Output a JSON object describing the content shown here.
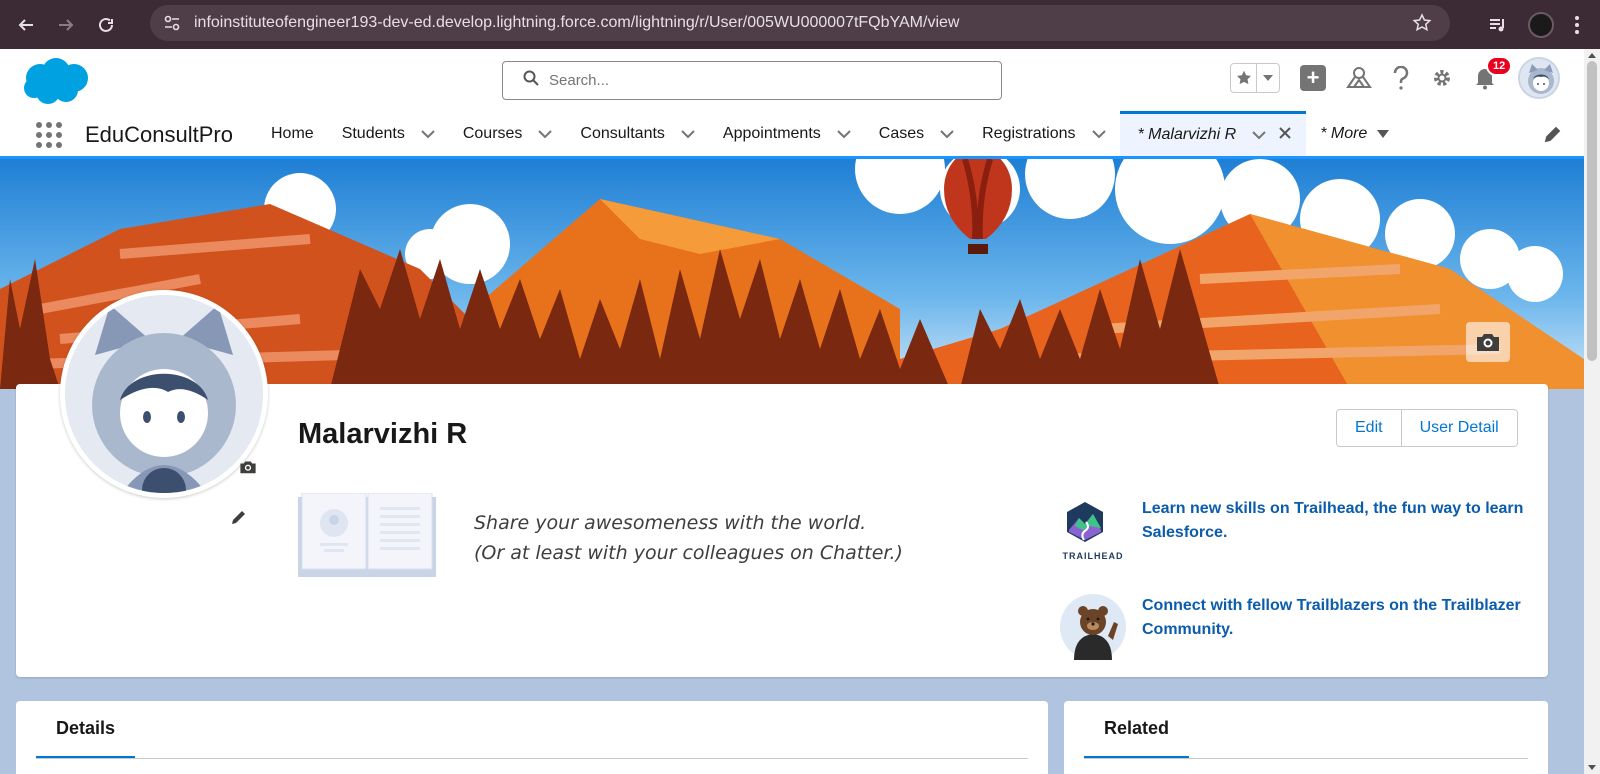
{
  "browser": {
    "url": "infoinstituteofengineer193-dev-ed.develop.lightning.force.com/lightning/r/User/005WU000007tFQbYAM/view"
  },
  "header": {
    "search_placeholder": "Search...",
    "notification_count": "12"
  },
  "nav": {
    "app_name": "EduConsultPro",
    "items": [
      {
        "label": "Home",
        "has_menu": false
      },
      {
        "label": "Students",
        "has_menu": true
      },
      {
        "label": "Courses",
        "has_menu": true
      },
      {
        "label": "Consultants",
        "has_menu": true
      },
      {
        "label": "Appointments",
        "has_menu": true
      },
      {
        "label": "Cases",
        "has_menu": true
      },
      {
        "label": "Registrations",
        "has_menu": true
      }
    ],
    "active_tab": "* Malarvizhi R",
    "more_label": "* More"
  },
  "profile": {
    "name": "Malarvizhi R",
    "edit_button": "Edit",
    "user_detail_button": "User Detail",
    "about_line1": "Share your awesomeness with the world.",
    "about_line2": "(Or at least with your colleagues on Chatter.)",
    "trailhead_label": "TRAILHEAD",
    "promo_trailhead": "Learn new skills on Trailhead, the fun way to learn Salesforce.",
    "promo_community": "Connect with fellow Trailblazers on the Trailblazer Community."
  },
  "panels": {
    "details_tab": "Details",
    "related_tab": "Related"
  },
  "colors": {
    "brand_blue": "#0176d3",
    "link_blue": "#0b5cab",
    "browser_chrome": "#3c2a34",
    "badge_red": "#ea001e"
  }
}
